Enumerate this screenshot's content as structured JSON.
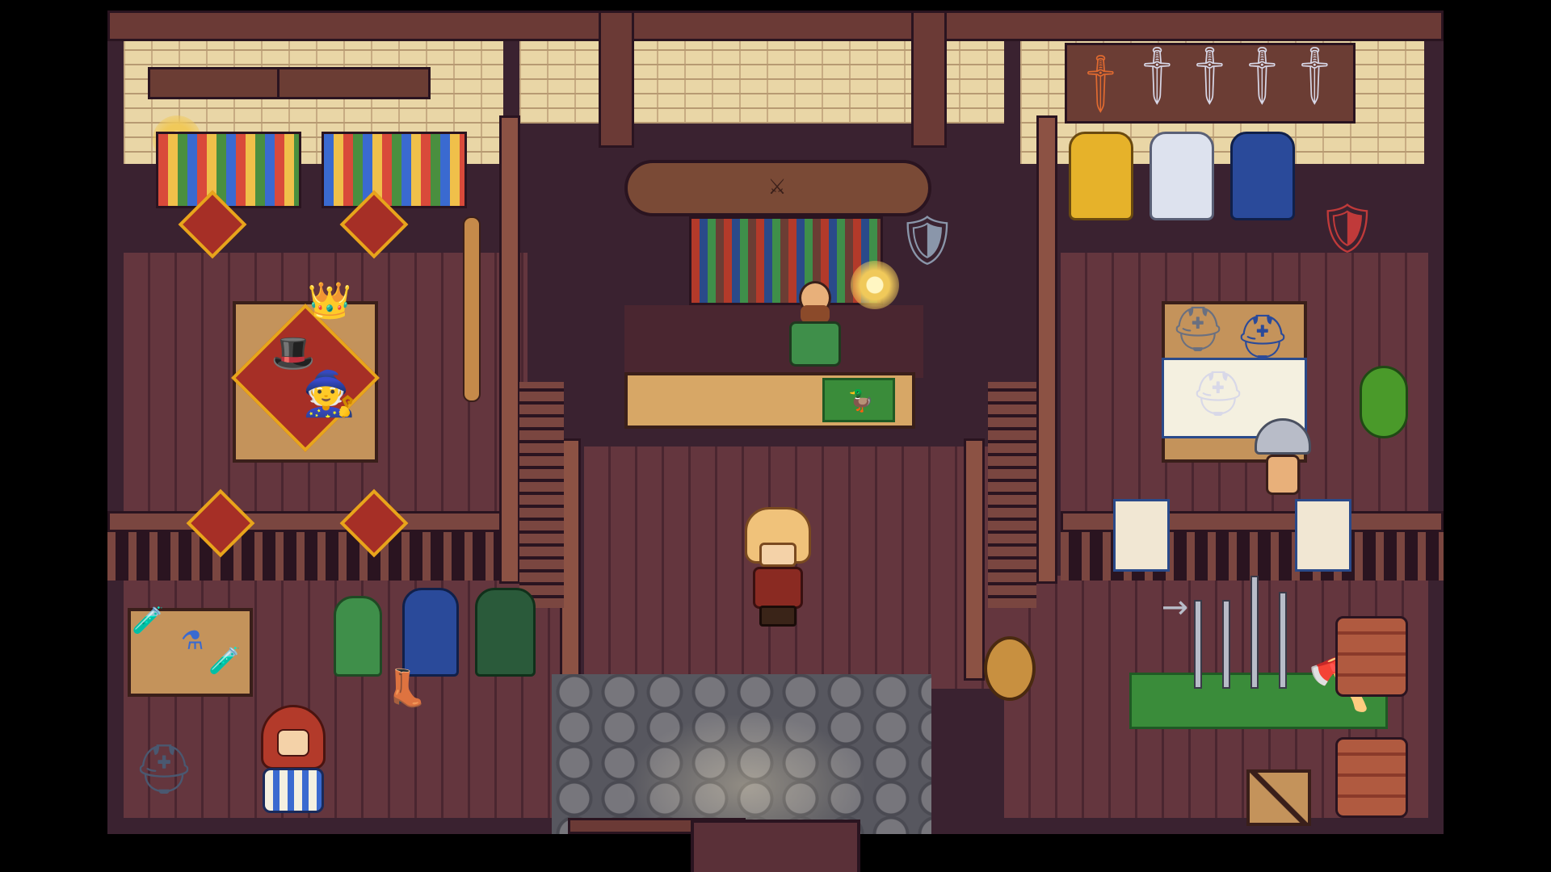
{
  "game": {
    "scene": "shop-interior",
    "palette": {
      "floor": "#5a3038",
      "wall": "#e9d6a6",
      "beam": "#6b3a36",
      "counter": "#d7a766",
      "rug_red": "#a62f26",
      "rug_gold": "#e8a51b",
      "stone": "#57575f",
      "banner_blue": "#2a4a8a",
      "player_hair": "#f0c27a",
      "npc_green": "#3f8f4a",
      "hood_red": "#b33a2a"
    },
    "icons": {
      "sign": "crossed-swords-sign-icon",
      "lamp": "lamp-icon",
      "sword": "sword-icon",
      "shield": "shield-icon",
      "helmet": "helmet-icon",
      "armor": "armor-icon",
      "potion": "potion-icon",
      "hat": "hat-icon",
      "cloak": "cloak-icon",
      "boots": "boots-icon",
      "spear": "spear-icon",
      "axe": "axe-icon",
      "crate": "crate-icon",
      "duck_mat": "duck-mat-icon"
    }
  }
}
